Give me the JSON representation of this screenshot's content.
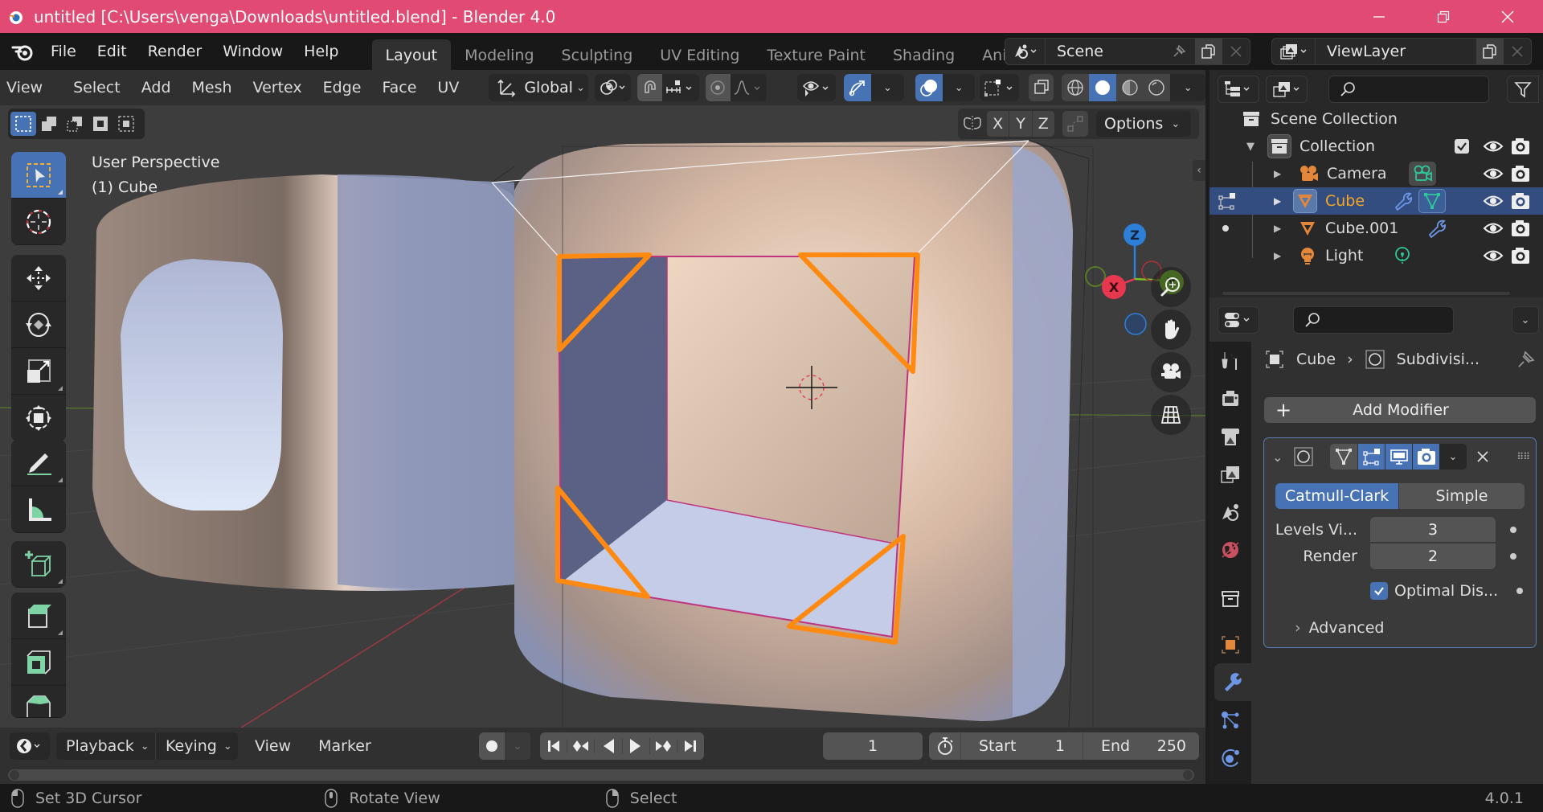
{
  "window": {
    "title": "untitled [C:\\Users\\venga\\Downloads\\untitled.blend] - Blender 4.0",
    "minimize_icon": "minimize-icon",
    "restore_icon": "restore-icon",
    "close_icon": "close-icon"
  },
  "menubar": {
    "items": [
      "File",
      "Edit",
      "Render",
      "Window",
      "Help"
    ],
    "workspaces": [
      "Layout",
      "Modeling",
      "Sculpting",
      "UV Editing",
      "Texture Paint",
      "Shading",
      "Ani"
    ],
    "active_workspace": "Layout",
    "scene": "Scene",
    "view_layer": "ViewLayer"
  },
  "viewport": {
    "menus": [
      "View",
      "Select",
      "Add",
      "Mesh",
      "Vertex",
      "Edge",
      "Face",
      "UV"
    ],
    "transform_orientation": "Global",
    "mirror_axes": [
      "X",
      "Y",
      "Z"
    ],
    "options_label": "Options",
    "view_name": "User Perspective",
    "object_info": "(1) Cube",
    "gizmo_axes": {
      "x": "X",
      "y": "Y",
      "z": "Z"
    },
    "shading_mode": "solid",
    "colors": {
      "x_axis": "#e8384f",
      "y_axis": "#78c026",
      "z_axis": "#2e7fd8",
      "edge_highlight": "#ff8a12",
      "selected_face_edge": "#c0347e"
    }
  },
  "tools": [
    "select-box",
    "cursor",
    "move",
    "rotate",
    "scale",
    "transform",
    "annotate",
    "measure",
    "add-cube",
    "extrude-region",
    "inset-faces",
    "bevel"
  ],
  "timeline": {
    "menus": [
      "Playback",
      "Keying",
      "View",
      "Marker"
    ],
    "current_frame": "1",
    "start_label": "Start",
    "start": "1",
    "end_label": "End",
    "end": "250"
  },
  "statusbar": {
    "hints": [
      "Set 3D Cursor",
      "Rotate View",
      "Select"
    ],
    "version": "4.0.1"
  },
  "outliner": {
    "scene_collection": "Scene Collection",
    "collection": "Collection",
    "items": [
      {
        "name": "Camera",
        "type": "camera",
        "selected": false
      },
      {
        "name": "Cube",
        "type": "mesh",
        "selected": true,
        "active": true
      },
      {
        "name": "Cube.001",
        "type": "mesh",
        "selected": false
      },
      {
        "name": "Light",
        "type": "light",
        "selected": false
      }
    ]
  },
  "properties": {
    "breadcrumb_object": "Cube",
    "breadcrumb_modifier": "Subdivisi...",
    "add_modifier": "Add Modifier",
    "modifier": {
      "type_options": [
        "Catmull-Clark",
        "Simple"
      ],
      "active_type": "Catmull-Clark",
      "levels_viewport_label": "Levels Vi...",
      "levels_viewport": "3",
      "render_label": "Render",
      "render": "2",
      "optimal_display_label": "Optimal Dis...",
      "optimal_display": true,
      "advanced_label": "Advanced"
    }
  }
}
